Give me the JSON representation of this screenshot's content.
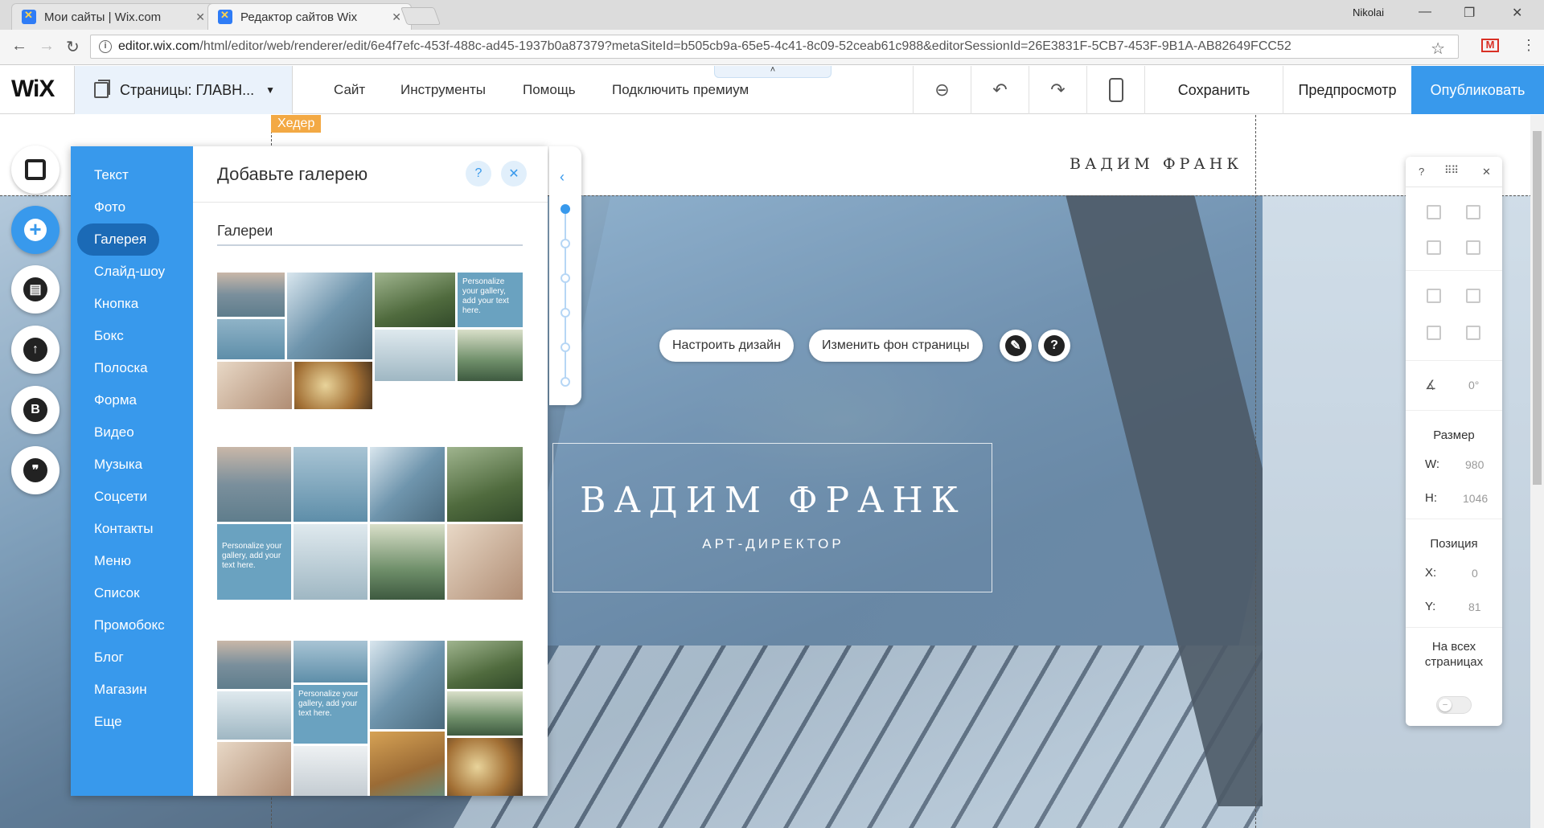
{
  "browser": {
    "tabs": [
      {
        "label": "Мои сайты | Wix.com",
        "active": false
      },
      {
        "label": "Редактор сайтов Wix",
        "active": true
      }
    ],
    "user": "Nikolai",
    "url_host": "editor.wix.com",
    "url_path": "/html/editor/web/renderer/edit/6e4f7efc-453f-488c-ad45-1937b0a87379?metaSiteId=b505cb9a-65e5-4c41-8c09-52ceab61c988&editorSessionId=26E3831F-5CB7-453F-9B1A-AB82649FCC52"
  },
  "wix_bar": {
    "logo": "WiX",
    "pages_label": "Страницы: ГЛАВН...",
    "menu": [
      "Сайт",
      "Инструменты",
      "Помощь",
      "Подключить премиум"
    ],
    "collapse_glyph": "˄",
    "save": "Сохранить",
    "preview": "Предпросмотр",
    "publish": "Опубликовать"
  },
  "canvas": {
    "header_tag": "Хедер",
    "header_name": "ВАДИМ ФРАНК",
    "hero_title": "ВАДИМ ФРАНК",
    "hero_subtitle": "АРТ-ДИРЕКТОР",
    "design_button": "Настроить дизайн",
    "bg_button": "Изменить фон страницы"
  },
  "add_panel": {
    "categories": [
      "Текст",
      "Фото",
      "Галерея",
      "Слайд-шоу",
      "Кнопка",
      "Бокс",
      "Полоска",
      "Форма",
      "Видео",
      "Музыка",
      "Соцсети",
      "Контакты",
      "Меню",
      "Список",
      "Промобокс",
      "Блог",
      "Магазин",
      "Еще"
    ],
    "active_category": "Галерея",
    "title": "Добавьте галерею",
    "help": "?",
    "close": "✕",
    "section": "Галереи",
    "placeholder_text": "Personalize your gallery, add your text here."
  },
  "inspector": {
    "help": "?",
    "close": "✕",
    "rotation": "0°",
    "size_label": "Размер",
    "w_key": "W:",
    "w_val": "980",
    "h_key": "H:",
    "h_val": "1046",
    "position_label": "Позиция",
    "x_key": "X:",
    "x_val": "0",
    "y_key": "Y:",
    "y_val": "81",
    "all_pages_label": "На всех страницах"
  },
  "colors": {
    "wix_blue": "#3899ec",
    "header_tag": "#f3a944",
    "active_category": "#1b6ab6"
  }
}
